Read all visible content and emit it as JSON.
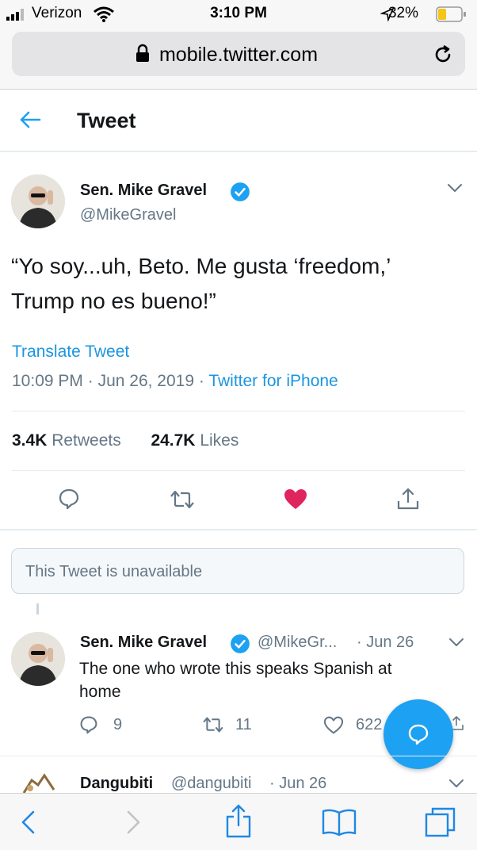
{
  "status_bar": {
    "carrier": "Verizon",
    "time": "3:10 PM",
    "battery": "32%"
  },
  "browser": {
    "url": "mobile.twitter.com"
  },
  "header": {
    "title": "Tweet"
  },
  "tweet": {
    "name": "Sen. Mike Gravel",
    "handle": "@MikeGravel",
    "text_line1": "“Yo soy...uh, Beto. Me gusta ‘freedom,’",
    "text_line2": "Trump no es bueno!”",
    "translate": "Translate Tweet",
    "time": "10:09 PM",
    "date": "Jun 26, 2019",
    "source": "Twitter for iPhone",
    "retweets_count": "3.4K",
    "retweets_label": "Retweets",
    "likes_count": "24.7K",
    "likes_label": "Likes"
  },
  "unavailable": {
    "text": "This Tweet is unavailable"
  },
  "reply": {
    "name": "Sen. Mike Gravel",
    "handle": "@MikeGr...",
    "date": "· Jun 26",
    "text_line1": "The one who wrote this speaks Spanish at",
    "text_line2": "home",
    "replies": "9",
    "retweets": "11",
    "likes": "622"
  },
  "next_tweet": {
    "name": "Dangubiti",
    "handle": "@dangubiti",
    "date": "· Jun 26"
  },
  "colors": {
    "accent": "#1da1f2",
    "link": "#1b95e0",
    "like": "#e0245e",
    "muted": "#657786"
  }
}
